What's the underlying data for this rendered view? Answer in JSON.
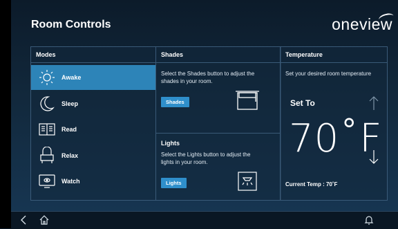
{
  "header": {
    "title": "Room Controls",
    "logo_text": "oneview"
  },
  "modes": {
    "title": "Modes",
    "items": [
      {
        "label": "Awake",
        "icon": "sun-icon",
        "active": true
      },
      {
        "label": "Sleep",
        "icon": "moon-icon",
        "active": false
      },
      {
        "label": "Read",
        "icon": "book-icon",
        "active": false
      },
      {
        "label": "Relax",
        "icon": "chair-icon",
        "active": false
      },
      {
        "label": "Watch",
        "icon": "tv-icon",
        "active": false
      }
    ]
  },
  "shades": {
    "title": "Shades",
    "description": "Select the Shades button to adjust the shades in your room.",
    "button_label": "Shades",
    "icon": "window-shade-icon"
  },
  "lights": {
    "title": "Lights",
    "description": "Select the Lights button to adjust the lights in your room.",
    "button_label": "Lights",
    "icon": "ceiling-light-icon"
  },
  "temperature": {
    "title": "Temperature",
    "description": "Set your desired room temperature",
    "set_to_label": "Set To",
    "set_value": "70˚F",
    "current_temp": "Current Temp : 70˚F"
  },
  "colors": {
    "accent": "#2d84b8",
    "button": "#2f8fcb",
    "panel_border": "#3a5a78"
  },
  "bottom_bar": {
    "icons": [
      "back-icon",
      "home-icon",
      "bell-icon"
    ]
  }
}
